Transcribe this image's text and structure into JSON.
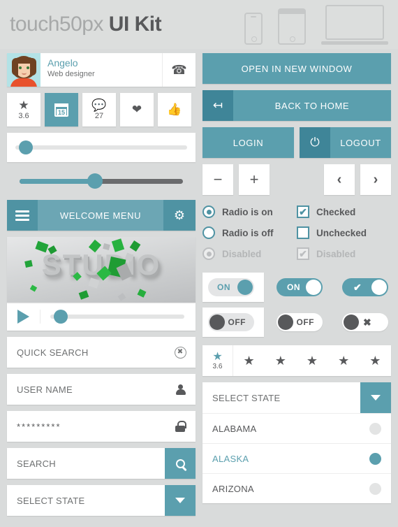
{
  "header": {
    "brand_light": "touch50px",
    "brand_bold": "UI Kit",
    "devices": [
      "phone-icon",
      "tablet-icon",
      "laptop-icon"
    ]
  },
  "colors": {
    "accent": "#5b9fae",
    "accent_dark": "#3f8598",
    "accent_mid": "#4f93a3",
    "background": "#d9dbdb",
    "text_dark": "#58595b",
    "text_muted": "#6e7071",
    "disabled": "#bcbec0"
  },
  "profile": {
    "name": "Angelo",
    "role": "Web designer",
    "call_icon": "phone-icon",
    "avatar": "user-avatar"
  },
  "tiles": [
    {
      "icon": "star-icon",
      "value": "3.6",
      "active": false
    },
    {
      "icon": "calendar-icon",
      "value": "15",
      "active": true
    },
    {
      "icon": "comment-icon",
      "value": "27",
      "active": false
    },
    {
      "icon": "heart-icon",
      "value": "",
      "active": false
    },
    {
      "icon": "thumbs-up-icon",
      "value": "",
      "active": false
    }
  ],
  "sliders": {
    "slider_one_percent": 6,
    "slider_two_percent": 46,
    "video_progress_percent": 8
  },
  "menu": {
    "hamburger_icon": "hamburger-icon",
    "title": "WELCOME MENU",
    "gear_icon": "gear-icon"
  },
  "video": {
    "image_text": "STUDIO",
    "play_icon": "play-icon"
  },
  "inputs": {
    "quick_search": {
      "label": "QUICK SEARCH",
      "icon": "clear-circle-icon"
    },
    "user_name": {
      "label": "USER NAME",
      "icon": "person-icon"
    },
    "password": {
      "value": "*********",
      "icon": "lock-icon"
    },
    "search": {
      "label": "SEARCH",
      "icon": "search-icon"
    },
    "select_state": {
      "label": "SELECT STATE",
      "icon": "chevron-down-icon"
    }
  },
  "buttons": {
    "open_new_window": "OPEN IN NEW WINDOW",
    "back_to_home": {
      "label": "BACK TO HOME",
      "icon": "back-arrow-icon"
    },
    "login": "LOGIN",
    "logout": {
      "label": "LOGOUT",
      "icon": "power-icon"
    },
    "minus": "−",
    "plus": "+",
    "prev": "‹",
    "next": "›"
  },
  "radios": [
    {
      "label": "Radio is on",
      "state": "on"
    },
    {
      "label": "Radio is off",
      "state": "off"
    },
    {
      "label": "Disabled",
      "state": "disabled"
    }
  ],
  "checkboxes": [
    {
      "label": "Checked",
      "state": "checked",
      "mark": "✔"
    },
    {
      "label": "Unchecked",
      "state": "unchecked",
      "mark": ""
    },
    {
      "label": "Disabled",
      "state": "disabled",
      "mark": "✔"
    }
  ],
  "toggles": [
    {
      "label": "ON",
      "style": "light-boxed",
      "state": "on"
    },
    {
      "label": "ON",
      "style": "teal",
      "state": "on"
    },
    {
      "label": "✔",
      "style": "teal-mark",
      "state": "on"
    },
    {
      "label": "OFF",
      "style": "light-boxed",
      "state": "off"
    },
    {
      "label": "OFF",
      "style": "white",
      "state": "off"
    },
    {
      "label": "✖",
      "style": "white-mark",
      "state": "off"
    }
  ],
  "rating": {
    "value": "3.6",
    "first_star_icon": "star-icon",
    "stars": [
      "star-icon",
      "star-icon",
      "star-icon",
      "star-icon",
      "star-icon"
    ]
  },
  "state_dropdown": {
    "header_label": "SELECT STATE",
    "arrow_icon": "chevron-down-icon",
    "options": [
      {
        "label": "ALABAMA",
        "selected": false
      },
      {
        "label": "ALASKA",
        "selected": true
      },
      {
        "label": "ARIZONA",
        "selected": false
      }
    ]
  }
}
